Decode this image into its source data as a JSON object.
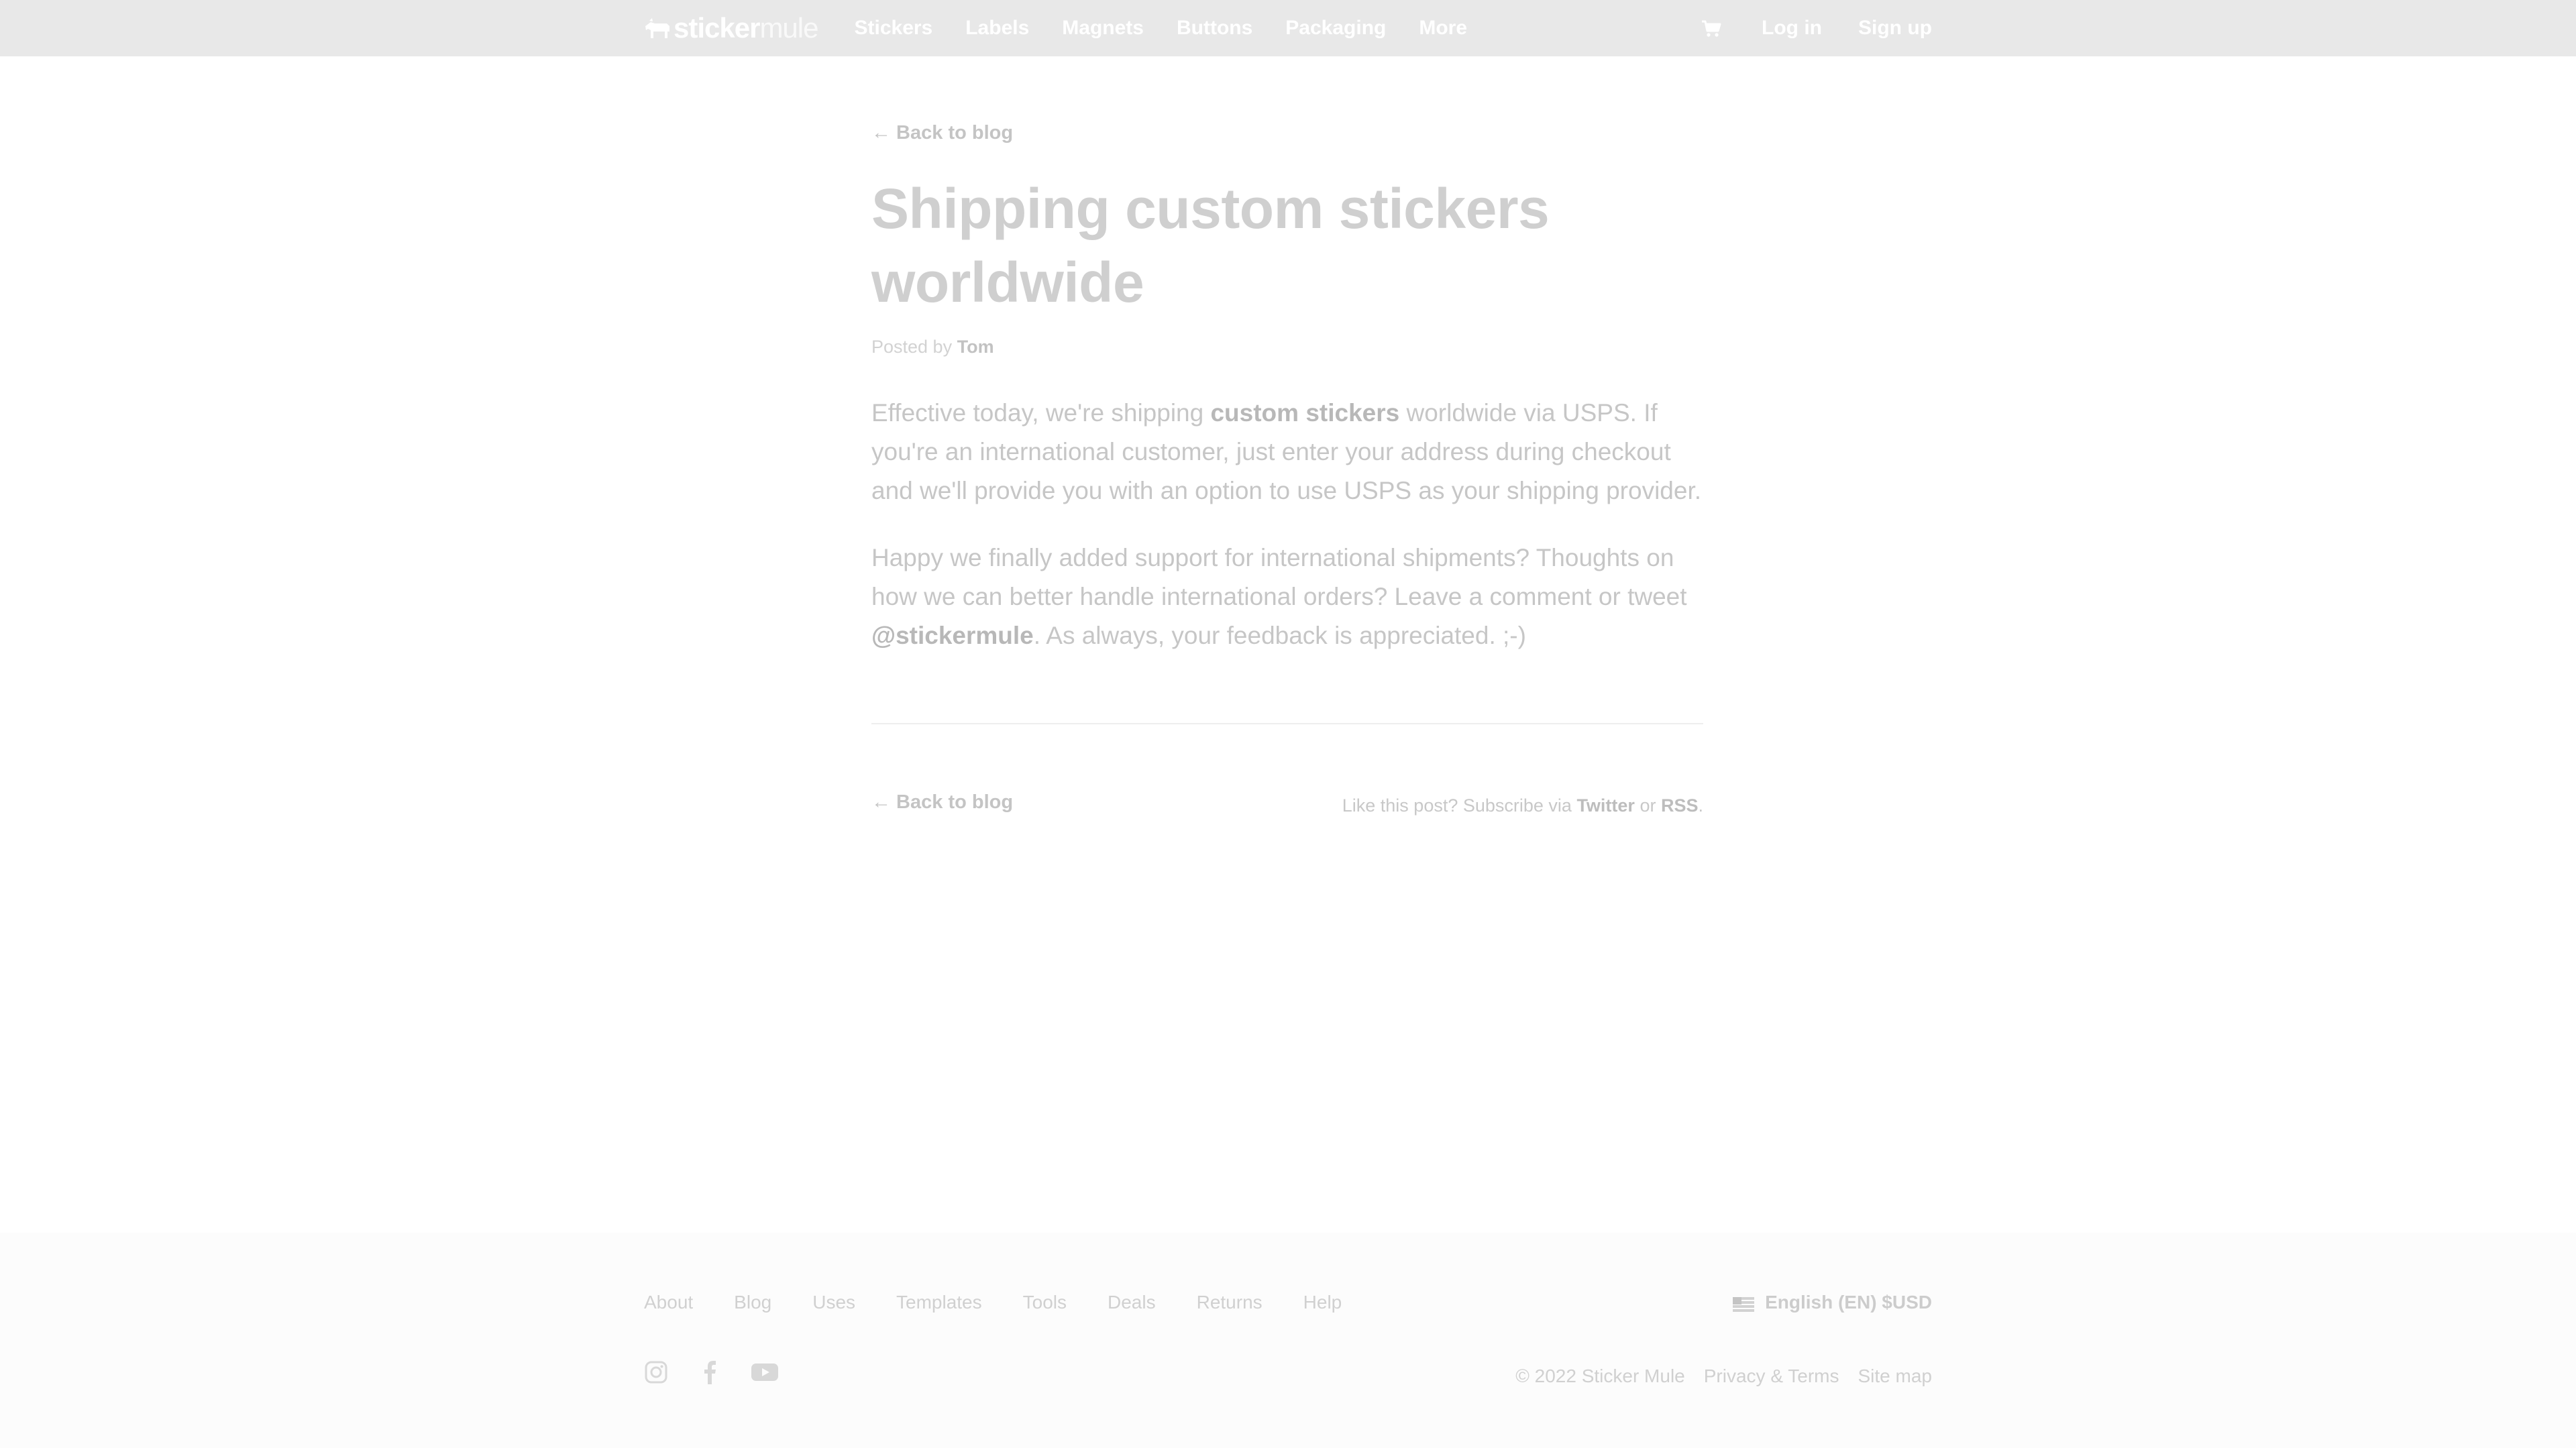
{
  "nav": {
    "logo_bold": "sticker",
    "logo_light": "mule",
    "items": [
      {
        "label": "Stickers"
      },
      {
        "label": "Labels"
      },
      {
        "label": "Magnets"
      },
      {
        "label": "Buttons"
      },
      {
        "label": "Packaging"
      },
      {
        "label": "More"
      }
    ],
    "cart_icon": "cart-icon",
    "login": "Log in",
    "signup": "Sign up"
  },
  "article": {
    "back_link": "← Back to blog",
    "title": "Shipping custom stickers worldwide",
    "posted_by": "Posted by",
    "author": "Tom",
    "p1_a": "Effective today, we're shipping ",
    "p1_link": "custom stickers",
    "p1_b": " worldwide via USPS. If you're an international customer, just enter your address during checkout and we'll provide you with an option to use USPS as your shipping provider.",
    "p2_a": "Happy we finally added support for international shipments? Thoughts on how we can better handle international orders? Leave a comment or tweet ",
    "p2_link": "@stickermule",
    "p2_b": ". As always, your feedback is appreciated. ;-)",
    "subscribe_a": "Like this post? Subscribe via ",
    "subscribe_twitter": "Twitter",
    "subscribe_or": " or ",
    "subscribe_rss": "RSS",
    "subscribe_end": "."
  },
  "footer": {
    "links": [
      {
        "label": "About"
      },
      {
        "label": "Blog"
      },
      {
        "label": "Uses"
      },
      {
        "label": "Templates"
      },
      {
        "label": "Tools"
      },
      {
        "label": "Deals"
      },
      {
        "label": "Returns"
      },
      {
        "label": "Help"
      }
    ],
    "language": "English (EN) $USD",
    "social_icons": [
      "instagram-icon",
      "facebook-icon",
      "youtube-icon"
    ],
    "copyright": "© 2022 Sticker Mule",
    "privacy": "Privacy & Terms",
    "sitemap": "Site map"
  },
  "colors": {
    "topbar_bg": "#e8e8e8",
    "footer_bg": "#fcfcfc"
  }
}
